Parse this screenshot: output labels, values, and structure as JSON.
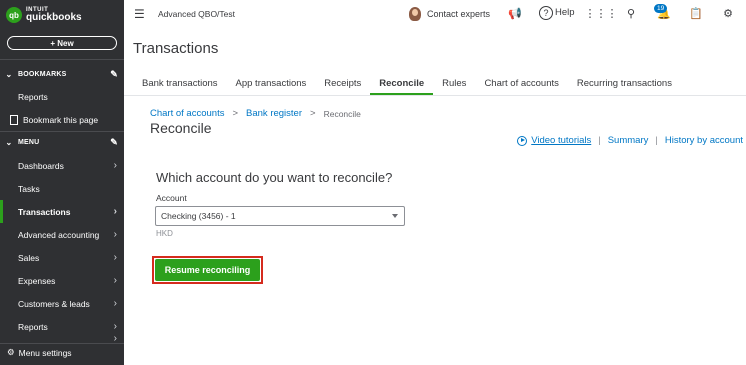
{
  "sidebar": {
    "logo": {
      "mark": "qb",
      "intuit": "INTUIT",
      "name": "quickbooks"
    },
    "new_button": "+ New",
    "bookmarks_header": "BOOKMARKS",
    "bookmark_items": [
      {
        "label": "Reports"
      },
      {
        "label": "Bookmark this page"
      }
    ],
    "menu_header": "MENU",
    "menu_items": [
      {
        "label": "Dashboards",
        "arrow": "›"
      },
      {
        "label": "Tasks",
        "arrow": ""
      },
      {
        "label": "Transactions",
        "arrow": "›",
        "active": true
      },
      {
        "label": "Advanced accounting",
        "arrow": "›"
      },
      {
        "label": "Sales",
        "arrow": "›"
      },
      {
        "label": "Expenses",
        "arrow": "›"
      },
      {
        "label": "Customers & leads",
        "arrow": "›"
      },
      {
        "label": "Reports",
        "arrow": "›"
      },
      {
        "label": "",
        "arrow": "›"
      }
    ],
    "menu_settings": "Menu settings"
  },
  "topbar": {
    "company": "Advanced QBO/Test",
    "contact_experts": "Contact experts",
    "help": "Help",
    "notification_count": "19"
  },
  "page": {
    "title": "Transactions",
    "tabs": [
      {
        "label": "Bank transactions"
      },
      {
        "label": "App transactions"
      },
      {
        "label": "Receipts"
      },
      {
        "label": "Reconcile",
        "active": true
      },
      {
        "label": "Rules"
      },
      {
        "label": "Chart of accounts"
      },
      {
        "label": "Recurring transactions"
      }
    ]
  },
  "breadcrumb": {
    "items": [
      "Chart of accounts",
      "Bank register"
    ],
    "current": "Reconcile",
    "separator": ">"
  },
  "reconcile": {
    "title": "Reconcile",
    "links": {
      "video": "Video tutorials",
      "summary": "Summary",
      "history": "History by account",
      "separator": "|"
    },
    "question": "Which account do you want to reconcile?",
    "account_label": "Account",
    "account_value": "Checking (3456) - 1",
    "currency": "HKD",
    "resume_button": "Resume reconciling"
  },
  "colors": {
    "sidebar_bg": "#2f3033",
    "accent_green": "#2ca01c",
    "link_blue": "#0077c5",
    "highlight_red": "#d52b1e"
  }
}
